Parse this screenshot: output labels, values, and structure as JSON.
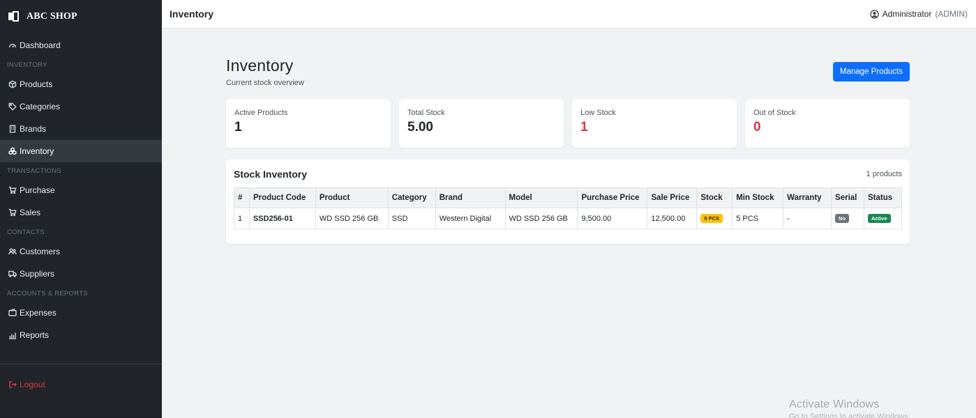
{
  "sidebar": {
    "brand": "ABC SHOP",
    "items": [
      {
        "label": "Dashboard",
        "icon": "speedometer-icon"
      },
      {
        "section": "INVENTORY"
      },
      {
        "label": "Products",
        "icon": "box-icon"
      },
      {
        "label": "Categories",
        "icon": "tag-icon"
      },
      {
        "label": "Brands",
        "icon": "building-icon"
      },
      {
        "label": "Inventory",
        "icon": "boxes-icon",
        "active": true
      },
      {
        "section": "TRANSACTIONS"
      },
      {
        "label": "Purchase",
        "icon": "cart-icon"
      },
      {
        "label": "Sales",
        "icon": "cart-icon"
      },
      {
        "section": "CONTACTS"
      },
      {
        "label": "Customers",
        "icon": "people-icon"
      },
      {
        "label": "Suppliers",
        "icon": "truck-icon"
      },
      {
        "section": "ACCOUNTS & REPORTS"
      },
      {
        "label": "Expenses",
        "icon": "wallet-icon"
      },
      {
        "label": "Reports",
        "icon": "bar-chart-icon"
      }
    ],
    "logout_label": "Logout"
  },
  "topbar": {
    "title": "Inventory",
    "user_name": "Administrator",
    "user_role": "(ADMIN)"
  },
  "page": {
    "title": "Inventory",
    "subtitle": "Current stock overview",
    "manage_button": "Manage Products"
  },
  "stats": [
    {
      "label": "Active Products",
      "value": "1",
      "status": "default"
    },
    {
      "label": "Total Stock",
      "value": "5.00",
      "status": "default"
    },
    {
      "label": "Low Stock",
      "value": "1",
      "status": "danger"
    },
    {
      "label": "Out of Stock",
      "value": "0",
      "status": "danger"
    }
  ],
  "stock_inventory": {
    "title": "Stock Inventory",
    "count_label": "1 products",
    "columns": [
      "#",
      "Product Code",
      "Product",
      "Category",
      "Brand",
      "Model",
      "Purchase Price",
      "Sale Price",
      "Stock",
      "Min Stock",
      "Warranty",
      "Serial",
      "Status"
    ],
    "rows": [
      {
        "index": "1",
        "code": "SSD256-01",
        "product": "WD SSD 256 GB",
        "category": "SSD",
        "brand": "Western Digital",
        "model": "WD SSD 256 GB",
        "purchase_price": "9,500.00",
        "sale_price": "12,500.00",
        "stock": "5 PCS",
        "min_stock": "5 PCS",
        "warranty": "-",
        "serial": "No",
        "status": "Active"
      }
    ]
  },
  "watermark": {
    "title": "Activate Windows",
    "subtitle": "Go to Settings to activate Windows."
  },
  "colors": {
    "sidebar_bg": "#212529",
    "primary": "#0d6efd",
    "danger": "#dc3545",
    "warning": "#ffc107",
    "success": "#198754",
    "secondary": "#6c757d"
  }
}
